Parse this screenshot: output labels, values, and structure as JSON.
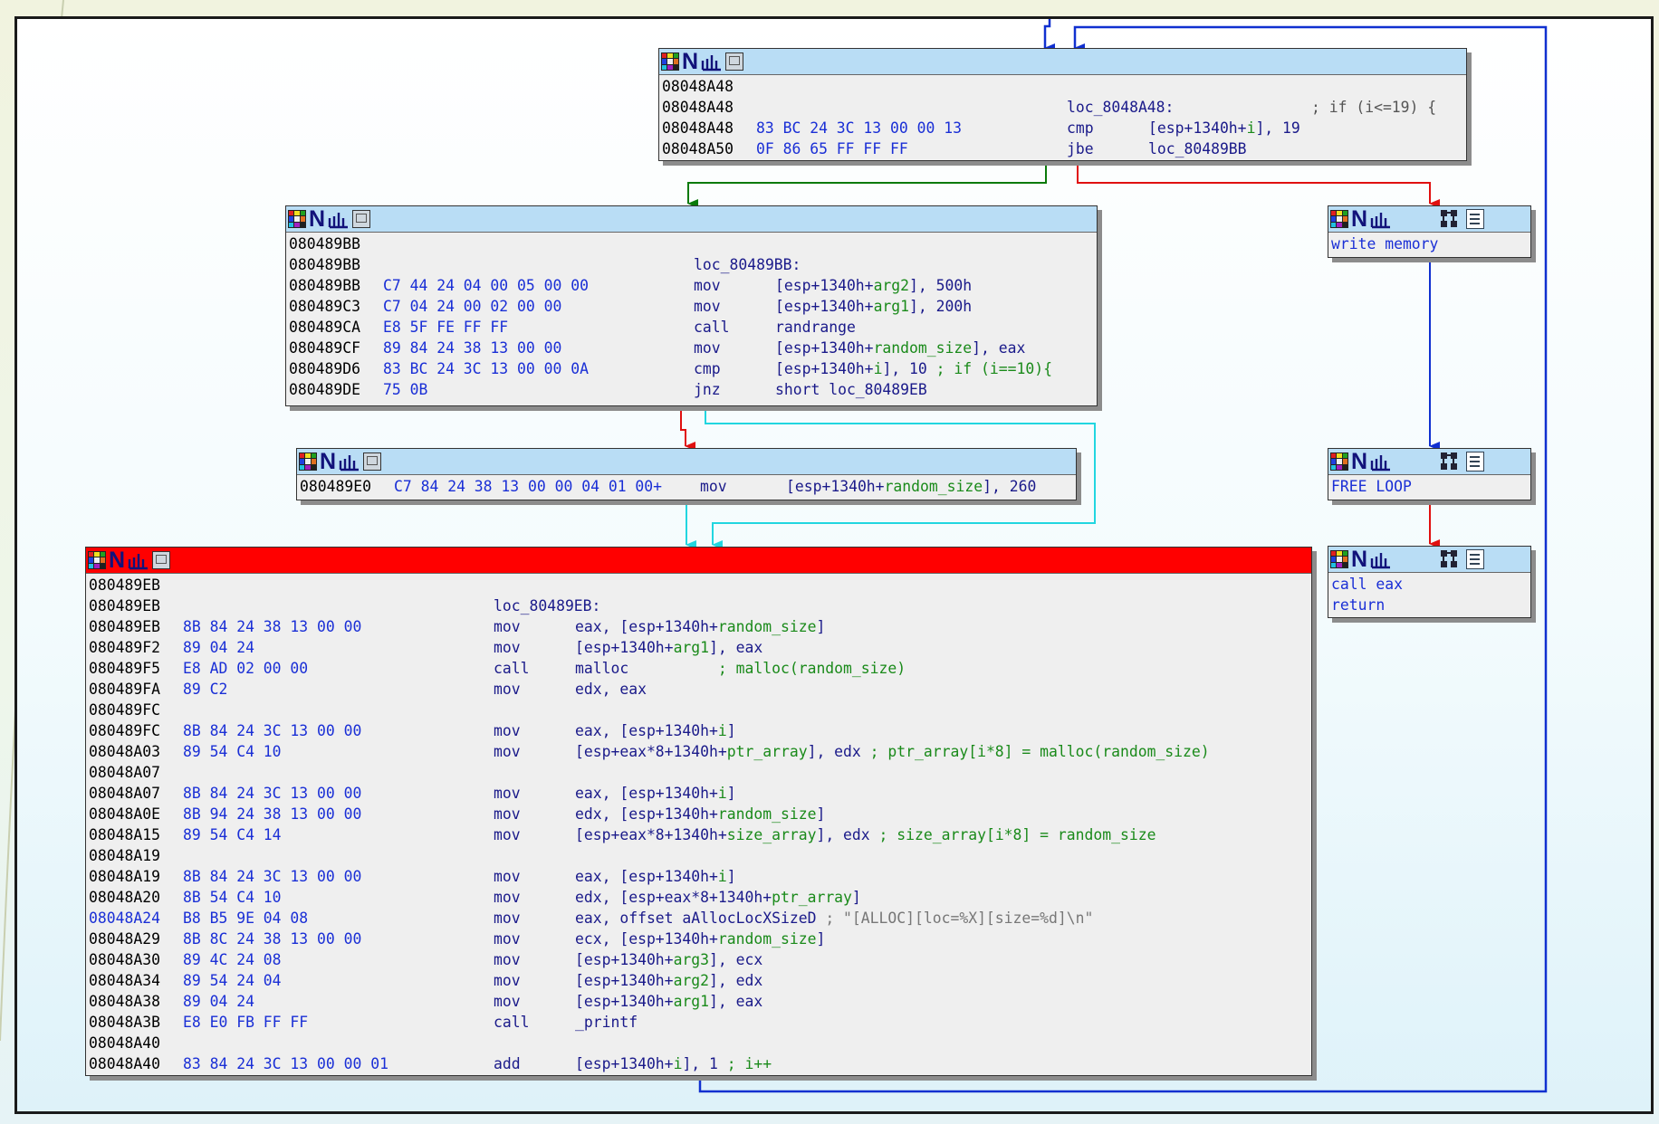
{
  "nodes": {
    "loop_header": {
      "lines": [
        {
          "addr": "08048A48"
        },
        {
          "addr": "08048A48",
          "label": "loc_8048A48:",
          "comment": "; if (i<=19) {"
        },
        {
          "addr": "08048A48",
          "bytes": "83 BC 24 3C 13 00 00 13",
          "mnemonic": "cmp",
          "op_a": "[esp+1340h+",
          "op_var": "i",
          "op_b": "], 19"
        },
        {
          "addr": "08048A50",
          "bytes": "0F 86 65 FF FF FF",
          "mnemonic": "jbe",
          "op_a": "loc_80489BB"
        }
      ]
    },
    "loop_body": {
      "lines": [
        {
          "addr": "080489BB"
        },
        {
          "addr": "080489BB",
          "label": "loc_80489BB:"
        },
        {
          "addr": "080489BB",
          "bytes": "C7 44 24 04 00 05 00 00",
          "mnemonic": "mov",
          "op_a": "[esp+1340h+",
          "op_var": "arg2",
          "op_b": "], 500h"
        },
        {
          "addr": "080489C3",
          "bytes": "C7 04 24 00 02 00 00",
          "mnemonic": "mov",
          "op_a": "[esp+1340h+",
          "op_var": "arg1",
          "op_b": "], 200h"
        },
        {
          "addr": "080489CA",
          "bytes": "E8 5F FE FF FF",
          "mnemonic": "call",
          "op_a": "randrange"
        },
        {
          "addr": "080489CF",
          "bytes": "89 84 24 38 13 00 00",
          "mnemonic": "mov",
          "op_a": "[esp+1340h+",
          "op_var": "random_size",
          "op_b": "], eax"
        },
        {
          "addr": "080489D6",
          "bytes": "83 BC 24 3C 13 00 00 0A",
          "mnemonic": "cmp",
          "op_a": "[esp+1340h+",
          "op_var": "i",
          "op_b": "], 10 ",
          "comment": "; if (i==10){"
        },
        {
          "addr": "080489DE",
          "bytes": "75 0B",
          "mnemonic": "jnz",
          "op_a": "short loc_80489EB"
        }
      ]
    },
    "set_size": {
      "lines": [
        {
          "addr": "080489E0",
          "bytes": "C7 84 24 38 13 00 00 04 01 00+",
          "mnemonic": "mov",
          "op_a": "[esp+1340h+",
          "op_var": "random_size",
          "op_b": "], 260"
        }
      ]
    },
    "alloc": {
      "lines": [
        {
          "addr": "080489EB"
        },
        {
          "addr": "080489EB",
          "label": "loc_80489EB:"
        },
        {
          "addr": "080489EB",
          "bytes": "8B 84 24 38 13 00 00",
          "mnemonic": "mov",
          "op_a": "eax, [esp+1340h+",
          "op_var": "random_size",
          "op_b": "]"
        },
        {
          "addr": "080489F2",
          "bytes": "89 04 24",
          "mnemonic": "mov",
          "op_a": "[esp+1340h+",
          "op_var": "arg1",
          "op_b": "], eax"
        },
        {
          "addr": "080489F5",
          "bytes": "E8 AD 02 00 00",
          "mnemonic": "call",
          "op_a": "malloc          ",
          "comment": "; malloc(random_size)"
        },
        {
          "addr": "080489FA",
          "bytes": "89 C2",
          "mnemonic": "mov",
          "op_a": "edx, eax"
        },
        {
          "addr": "080489FC"
        },
        {
          "addr": "080489FC",
          "bytes": "8B 84 24 3C 13 00 00",
          "mnemonic": "mov",
          "op_a": "eax, [esp+1340h+",
          "op_var": "i",
          "op_b": "]"
        },
        {
          "addr": "08048A03",
          "bytes": "89 54 C4 10",
          "mnemonic": "mov",
          "op_a": "[esp+eax*8+1340h+",
          "op_var": "ptr_array",
          "op_b": "], edx ",
          "comment": "; ptr_array[i*8] = malloc(random_size)"
        },
        {
          "addr": "08048A07"
        },
        {
          "addr": "08048A07",
          "bytes": "8B 84 24 3C 13 00 00",
          "mnemonic": "mov",
          "op_a": "eax, [esp+1340h+",
          "op_var": "i",
          "op_b": "]"
        },
        {
          "addr": "08048A0E",
          "bytes": "8B 94 24 38 13 00 00",
          "mnemonic": "mov",
          "op_a": "edx, [esp+1340h+",
          "op_var": "random_size",
          "op_b": "]"
        },
        {
          "addr": "08048A15",
          "bytes": "89 54 C4 14",
          "mnemonic": "mov",
          "op_a": "[esp+eax*8+1340h+",
          "op_var": "size_array",
          "op_b": "], edx ",
          "comment": "; size_array[i*8] = random_size"
        },
        {
          "addr": "08048A19"
        },
        {
          "addr": "08048A19",
          "bytes": "8B 84 24 3C 13 00 00",
          "mnemonic": "mov",
          "op_a": "eax, [esp+1340h+",
          "op_var": "i",
          "op_b": "]"
        },
        {
          "addr": "08048A20",
          "bytes": "8B 54 C4 10",
          "mnemonic": "mov",
          "op_a": "edx, [esp+eax*8+1340h+",
          "op_var": "ptr_array",
          "op_b": "]"
        },
        {
          "addr": "08048A24",
          "addr_blue": true,
          "bytes": "B8 B5 9E 04 08",
          "mnemonic": "mov",
          "op_a": "eax, offset aAllocLocXSizeD ",
          "string": "; \"[ALLOC][loc=%X][size=%d]\\n\""
        },
        {
          "addr": "08048A29",
          "bytes": "8B 8C 24 38 13 00 00",
          "mnemonic": "mov",
          "op_a": "ecx, [esp+1340h+",
          "op_var": "random_size",
          "op_b": "]"
        },
        {
          "addr": "08048A30",
          "bytes": "89 4C 24 08",
          "mnemonic": "mov",
          "op_a": "[esp+1340h+",
          "op_var": "arg3",
          "op_b": "], ecx"
        },
        {
          "addr": "08048A34",
          "bytes": "89 54 24 04",
          "mnemonic": "mov",
          "op_a": "[esp+1340h+",
          "op_var": "arg2",
          "op_b": "], edx"
        },
        {
          "addr": "08048A38",
          "bytes": "89 04 24",
          "mnemonic": "mov",
          "op_a": "[esp+1340h+",
          "op_var": "arg1",
          "op_b": "], eax"
        },
        {
          "addr": "08048A3B",
          "bytes": "E8 E0 FB FF FF",
          "mnemonic": "call",
          "op_a": "_printf"
        },
        {
          "addr": "08048A40"
        },
        {
          "addr": "08048A40",
          "bytes": "83 84 24 3C 13 00 00 01",
          "mnemonic": "add",
          "op_a": "[esp+1340h+",
          "op_var": "i",
          "op_b": "], 1 ",
          "comment": "; i++"
        }
      ]
    },
    "write_memory": {
      "lines": [
        {
          "text": "write memory"
        }
      ]
    },
    "free_loop": {
      "lines": [
        {
          "text": "FREE LOOP"
        }
      ]
    },
    "call_eax": {
      "lines": [
        {
          "text": "call eax"
        },
        {
          "text": "return"
        }
      ]
    }
  },
  "icons": {
    "grid": "graph-overview-icon",
    "n": "name-icon",
    "wave": "xref-graph-icon",
    "box": "collapse-node-icon",
    "tree": "group-nodes-icon",
    "doc": "comment-icon"
  },
  "colors": {
    "edge_true": "#0a7a0a",
    "edge_false": "#e01010",
    "edge_unconditional": "#1030d0",
    "edge_fallthrough": "#22d6e0",
    "node_title": "#b9ddf5",
    "node_title_current": "#ff0000"
  }
}
